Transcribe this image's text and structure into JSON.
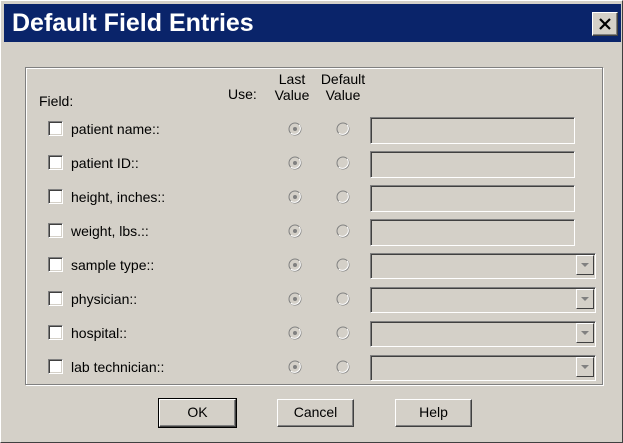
{
  "dialog": {
    "title": "Default Field Entries",
    "close_icon": "close-x-icon"
  },
  "headers": {
    "field": "Field:",
    "use": "Use:",
    "last_value_line1": "Last",
    "last_value_line2": "Value",
    "default_value_line1": "Default",
    "default_value_line2": "Value"
  },
  "rows": [
    {
      "label": "patient name::",
      "checked": false,
      "selected": "last",
      "input_type": "text",
      "value": ""
    },
    {
      "label": "patient ID::",
      "checked": false,
      "selected": "last",
      "input_type": "text",
      "value": ""
    },
    {
      "label": "height, inches::",
      "checked": false,
      "selected": "last",
      "input_type": "text",
      "value": ""
    },
    {
      "label": "weight, lbs.::",
      "checked": false,
      "selected": "last",
      "input_type": "text",
      "value": ""
    },
    {
      "label": "sample type::",
      "checked": false,
      "selected": "last",
      "input_type": "combo",
      "value": ""
    },
    {
      "label": "physician::",
      "checked": false,
      "selected": "last",
      "input_type": "combo",
      "value": ""
    },
    {
      "label": "hospital::",
      "checked": false,
      "selected": "last",
      "input_type": "combo",
      "value": ""
    },
    {
      "label": "lab technician::",
      "checked": false,
      "selected": "last",
      "input_type": "combo",
      "value": ""
    }
  ],
  "buttons": {
    "ok": "OK",
    "cancel": "Cancel",
    "help": "Help"
  },
  "colors": {
    "titlebar": "#0a246a",
    "face": "#d4d0c8"
  }
}
